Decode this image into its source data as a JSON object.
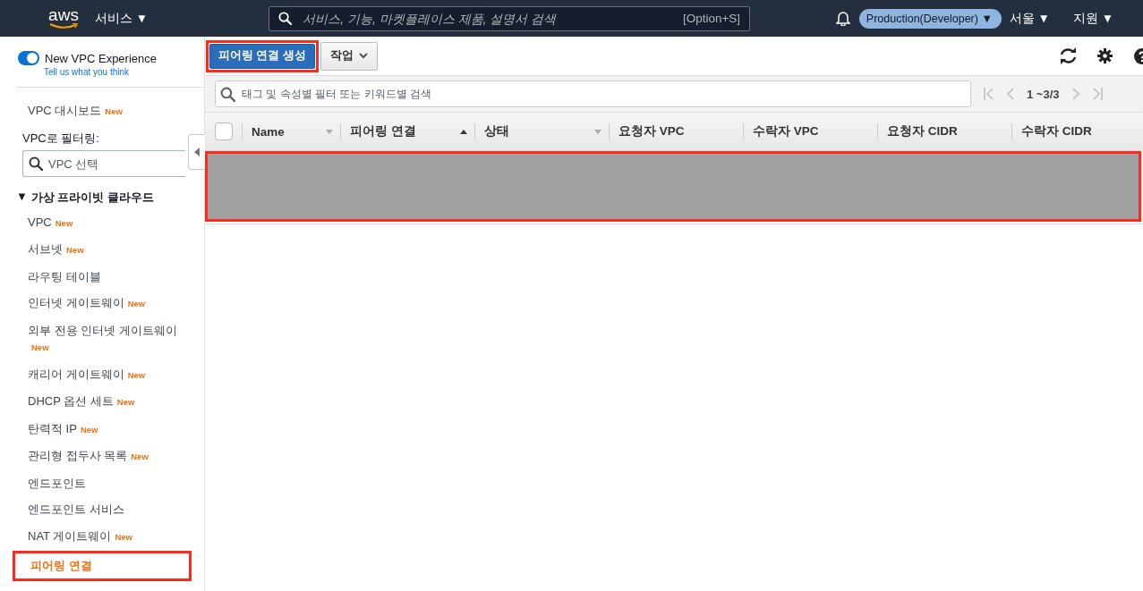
{
  "top_bar": {
    "logo": "aws",
    "services_menu": "서비스 ▼",
    "search": {
      "placeholder": "서비스, 기능, 마켓플레이스 제품, 설명서 검색",
      "shortcut": "[Option+S]"
    },
    "account": "Production(Developer) ▼",
    "region": "서울 ▼",
    "support": "지원 ▼"
  },
  "sidebar": {
    "toggle": {
      "label": "New VPC Experience",
      "on": true,
      "link": "Tell us what you think"
    },
    "dashboard": {
      "label": "VPC 대시보드",
      "badge": "New"
    },
    "filter": {
      "label": "VPC로 필터링:",
      "placeholder": "VPC 선택"
    },
    "section": {
      "title": "가상 프라이빗 클라우드",
      "marker": "▼",
      "expanded": true
    },
    "items": [
      {
        "label": "VPC",
        "badge": "New",
        "selected": false
      },
      {
        "label": "서브넷",
        "badge": "New",
        "selected": false
      },
      {
        "label": "라우팅 테이블",
        "selected": false
      },
      {
        "label": "인터넷 게이트웨이",
        "badge": "New",
        "selected": false
      },
      {
        "label": "외부 전용 인터넷 게이트웨이",
        "badge": "New",
        "selected": false
      },
      {
        "label": "캐리어 게이트웨이",
        "badge": "New",
        "selected": false
      },
      {
        "label": "DHCP 옵션 세트",
        "badge": "New",
        "selected": false
      },
      {
        "label": "탄력적 IP",
        "badge": "New",
        "selected": false
      },
      {
        "label": "관리형 접두사 목록",
        "badge": "New",
        "selected": false
      },
      {
        "label": "엔드포인트",
        "selected": false
      },
      {
        "label": "엔드포인트 서비스",
        "selected": false
      },
      {
        "label": "NAT 게이트웨이",
        "badge": "New",
        "selected": false
      },
      {
        "label": "피어링 연결",
        "selected": true
      }
    ]
  },
  "toolbar": {
    "create_button": "피어링 연결 생성",
    "actions_button": "작업"
  },
  "filter_bar": {
    "placeholder": "태그 및 속성별 필터 또는 키워드별 검색",
    "pagination": "1 ~3/3"
  },
  "table": {
    "columns": [
      {
        "label": "Name",
        "sort_active": false
      },
      {
        "label": "피어링 연결",
        "sort_active": true
      },
      {
        "label": "상태",
        "sort_active": false
      },
      {
        "label": "요청자 VPC"
      },
      {
        "label": "수락자 VPC"
      },
      {
        "label": "요청자 CIDR"
      },
      {
        "label": "수락자 CIDR"
      }
    ],
    "select_all_checked": false
  }
}
